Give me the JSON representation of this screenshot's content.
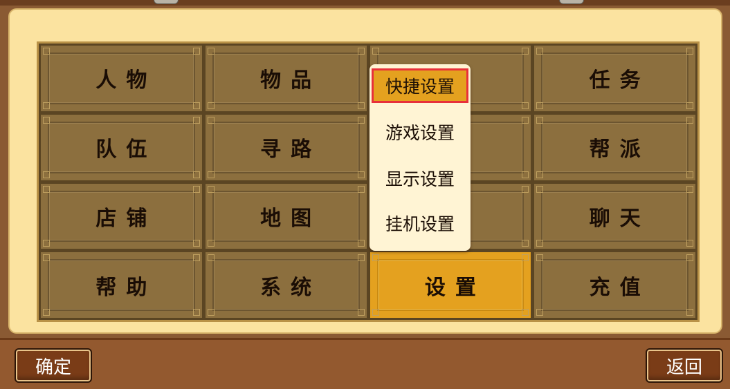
{
  "menu": {
    "cells": [
      {
        "label": "人物"
      },
      {
        "label": "物品"
      },
      {
        "label": ""
      },
      {
        "label": "任务"
      },
      {
        "label": "队伍"
      },
      {
        "label": "寻路"
      },
      {
        "label": ""
      },
      {
        "label": "帮派"
      },
      {
        "label": "店铺"
      },
      {
        "label": "地图"
      },
      {
        "label": ""
      },
      {
        "label": "聊天"
      },
      {
        "label": "帮助"
      },
      {
        "label": "系统"
      },
      {
        "label": "设置"
      },
      {
        "label": "充值"
      }
    ],
    "active_index": 14
  },
  "dropdown": {
    "items": [
      {
        "label": "快捷设置",
        "selected": true
      },
      {
        "label": "游戏设置"
      },
      {
        "label": "显示设置"
      },
      {
        "label": "挂机设置"
      }
    ]
  },
  "footer": {
    "confirm_label": "确定",
    "back_label": "返回"
  },
  "colors": {
    "panel": "#fbe3a0",
    "cell": "#8c6f3e",
    "active": "#e4a11f",
    "highlight_border": "#e8303a"
  }
}
